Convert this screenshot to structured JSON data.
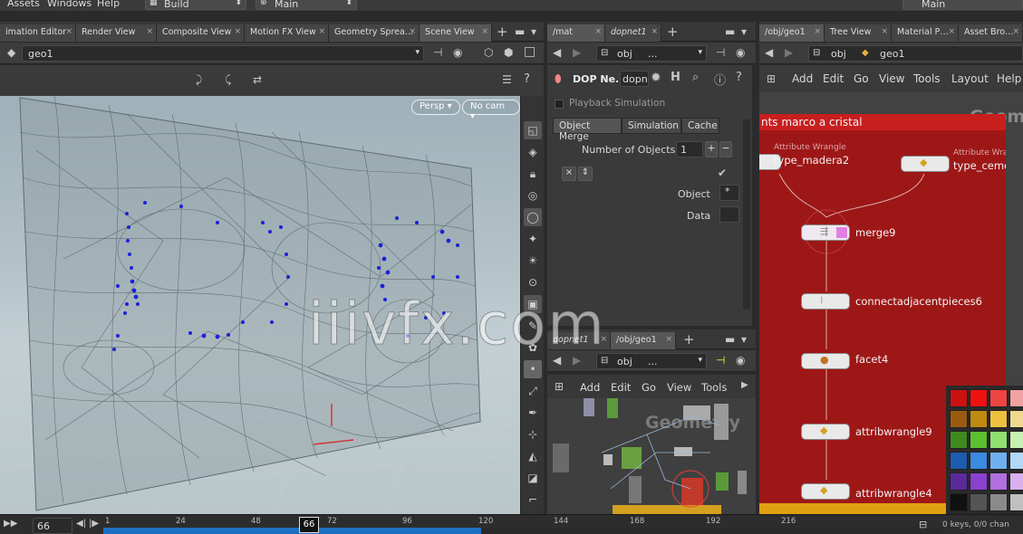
{
  "menu": {
    "items": [
      "Assets",
      "Windows",
      "Help"
    ],
    "desktop_build": "Build",
    "desktop_main": "Main",
    "right_main": "Main"
  },
  "left_pane": {
    "tabs": [
      "imation Editor",
      "Render View",
      "Composite View",
      "Motion FX View",
      "Geometry Sprea…",
      "Scene View"
    ],
    "path_value": "geo1",
    "persp_label": "Persp ▾",
    "cam_label": "No cam ▾"
  },
  "dop_pane": {
    "tabs": [
      "/mat",
      "dopnet1"
    ],
    "path_obj": "obj",
    "path_dots": "...",
    "node_type": "DOP Ne...",
    "node_name": "dopn",
    "playback": "Playback Simulation",
    "param_tabs": [
      "Object Merge",
      "Simulation",
      "Cache"
    ],
    "num_objects_label": "Number of Objects",
    "num_objects_value": "1",
    "object_label": "Object",
    "data_label": "Data"
  },
  "geo_pane": {
    "tabs": [
      "dopnet1",
      "/obj/geo1"
    ],
    "path_obj": "obj",
    "path_dots": "...",
    "menu": [
      "Add",
      "Edit",
      "Go",
      "View",
      "Tools"
    ],
    "watermark": "Geometry"
  },
  "right_pane": {
    "tabs": [
      "/obj/geo1",
      "Tree View",
      "Material P…",
      "Asset Bro…"
    ],
    "path_obj": "obj",
    "path_geo": "geo1",
    "menu": [
      "Add",
      "Edit",
      "Go",
      "View",
      "Tools",
      "Layout",
      "Help"
    ],
    "netbox_title": "nts marco a cristal",
    "watermark": "Geom",
    "nodes": [
      {
        "label": "type_madera2",
        "sub": "Attribute Wrangle"
      },
      {
        "label": "type_cemento",
        "sub": "Attribute Wrangle"
      },
      {
        "label": "merge9"
      },
      {
        "label": "connectadjacentpieces6"
      },
      {
        "label": "facet4"
      },
      {
        "label": "attribwrangle9"
      },
      {
        "label": "attribwrangle4"
      }
    ]
  },
  "timeline": {
    "frame_field": "66",
    "current_frame": "66",
    "ticks": [
      "1",
      "24",
      "48",
      "72",
      "96",
      "120",
      "144",
      "168",
      "192",
      "216"
    ],
    "keys_text": "0 keys, 0/0 chan"
  },
  "swatch_colors": [
    "#cc1111",
    "#ee1111",
    "#ee4444",
    "#f3a0a0",
    "#9a5a10",
    "#c08a10",
    "#eec040",
    "#f0d890",
    "#3e8a1e",
    "#5cc030",
    "#90e070",
    "#c8f0b0",
    "#1e5ab0",
    "#3a8ae0",
    "#70b0f0",
    "#b0d8f8",
    "#5a2a9a",
    "#8a40d0",
    "#b070e0",
    "#d8b0f0",
    "#111111",
    "#555555",
    "#8a8a8a",
    "#c0c0c0"
  ],
  "overlay_watermark": "iiivfx.com"
}
